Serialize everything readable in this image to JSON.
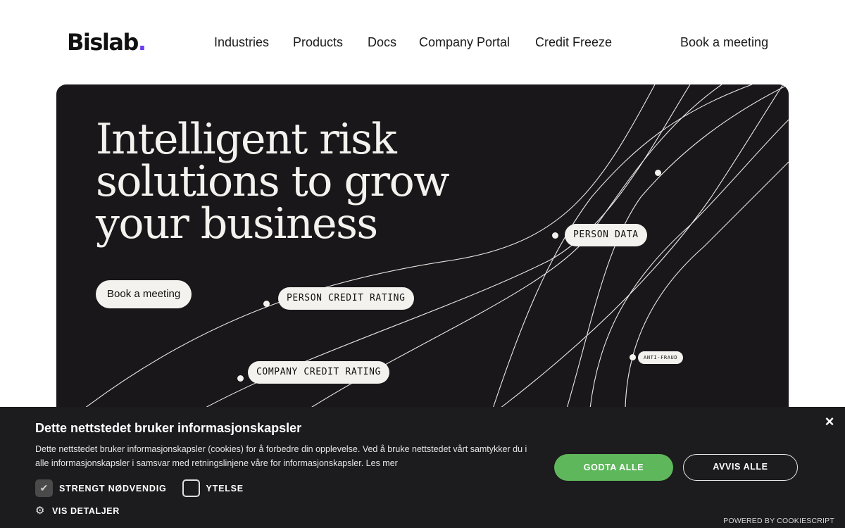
{
  "header": {
    "logo_text": "Bislab",
    "logo_dot": ".",
    "nav": [
      {
        "label": "Industries"
      },
      {
        "label": "Products"
      },
      {
        "label": "Docs"
      },
      {
        "label": "Company Portal"
      },
      {
        "label": "Credit Freeze"
      }
    ],
    "cta_label": "Book a meeting"
  },
  "hero": {
    "title": "Intelligent risk solutions to grow your business",
    "button_label": "Book a meeting",
    "tags": {
      "person_data": "PERSON DATA",
      "person_credit_rating": "PERSON CREDIT RATING",
      "company_credit_rating": "COMPANY CREDIT RATING",
      "anti_fraud": "ANTI-FRAUD"
    }
  },
  "cookie_banner": {
    "title": "Dette nettstedet bruker informasjonskapsler",
    "text": "Dette nettstedet bruker informasjonskapsler (cookies) for å forbedre din opplevelse. Ved å bruke nettstedet vårt samtykker du i alle informasjonskapsler i samsvar med retningslinjene våre for informasjonskapsler.",
    "read_more": "Les mer",
    "checkboxes": [
      {
        "label": "STRENGT NØDVENDIG",
        "checked": true
      },
      {
        "label": "YTELSE",
        "checked": false
      }
    ],
    "details_label": "VIS DETALJER",
    "accept_label": "GODTA ALLE",
    "reject_label": "AVVIS ALLE",
    "close_glyph": "×",
    "powered_by": "POWERED BY COOKIESCRIPT"
  },
  "colors": {
    "hero_bg": "#19171a",
    "logo_accent": "#6b3df0",
    "accept_green": "#5fb75c",
    "banner_bg": "#1c1b1d"
  }
}
